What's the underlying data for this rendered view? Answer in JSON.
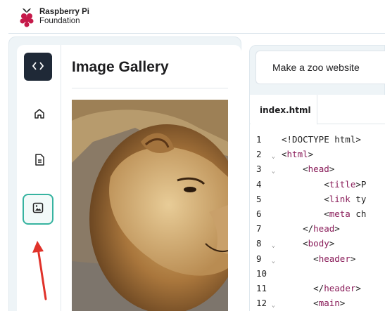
{
  "brand": {
    "line1": "Raspberry Pi",
    "line2": "Foundation"
  },
  "rail": {
    "items": [
      {
        "icon": "code-icon"
      },
      {
        "icon": "home-icon"
      },
      {
        "icon": "file-icon"
      },
      {
        "icon": "image-icon",
        "active": true
      }
    ]
  },
  "gallery": {
    "title": "Image Gallery",
    "image": "lion-photo"
  },
  "project": {
    "name": "Make a zoo website"
  },
  "editor": {
    "tab": "index.html",
    "lines": [
      {
        "n": "1",
        "fold": false,
        "pre": "",
        "tag": "",
        "text": "<!DOCTYPE html>"
      },
      {
        "n": "2",
        "fold": true,
        "pre": "<",
        "tag": "html",
        "text": ">"
      },
      {
        "n": "3",
        "fold": true,
        "pre": "    <",
        "tag": "head",
        "text": ">"
      },
      {
        "n": "4",
        "fold": false,
        "pre": "        <",
        "tag": "title",
        "text": ">P"
      },
      {
        "n": "5",
        "fold": false,
        "pre": "        <",
        "tag": "link",
        "text": " ty"
      },
      {
        "n": "6",
        "fold": false,
        "pre": "        <",
        "tag": "meta",
        "text": " ch"
      },
      {
        "n": "7",
        "fold": false,
        "pre": "    </",
        "tag": "head",
        "text": ">"
      },
      {
        "n": "8",
        "fold": true,
        "pre": "    <",
        "tag": "body",
        "text": ">"
      },
      {
        "n": "9",
        "fold": true,
        "pre": "      <",
        "tag": "header",
        "text": ">"
      },
      {
        "n": "10",
        "fold": false,
        "pre": "",
        "tag": "",
        "text": ""
      },
      {
        "n": "11",
        "fold": false,
        "pre": "      </",
        "tag": "header",
        "text": ">"
      },
      {
        "n": "12",
        "fold": true,
        "pre": "      <",
        "tag": "main",
        "text": ">"
      }
    ]
  },
  "colors": {
    "accent": "#36b3a0",
    "arrow": "#e0322a",
    "tag": "#8a1d5a",
    "rail_dark": "#1f2937"
  }
}
